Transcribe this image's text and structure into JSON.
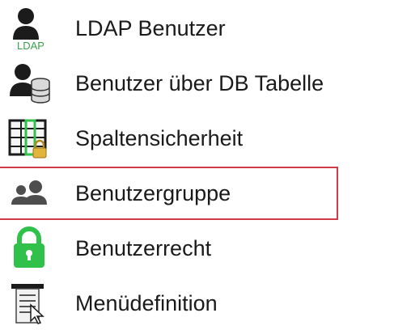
{
  "menu": {
    "items": [
      {
        "label": "LDAP Benutzer",
        "icon": "ldap-user-icon",
        "icon_caption": "LDAP"
      },
      {
        "label": "Benutzer über DB Tabelle",
        "icon": "user-database-icon"
      },
      {
        "label": "Spaltensicherheit",
        "icon": "column-security-icon"
      },
      {
        "label": "Benutzergruppe",
        "icon": "user-group-icon",
        "selected": true
      },
      {
        "label": "Benutzerrecht",
        "icon": "lock-icon"
      },
      {
        "label": "Menüdefinition",
        "icon": "menu-definition-icon"
      }
    ]
  },
  "colors": {
    "selection_border": "#d23a48",
    "lock_green": "#2fc14a",
    "ldap_caption_green": "#3aa24a",
    "icon_dark": "#1b1b1b",
    "group_gray": "#4d4d4d"
  }
}
